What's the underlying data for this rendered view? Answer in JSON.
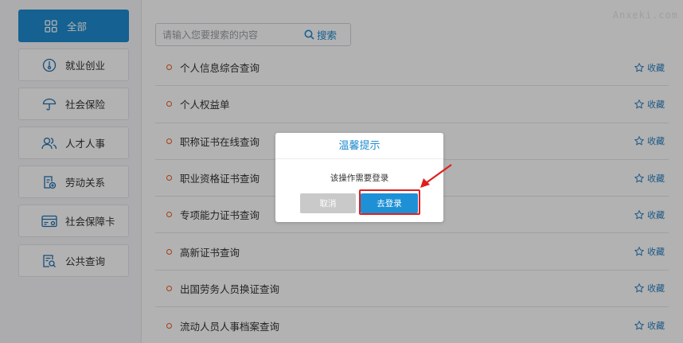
{
  "sidebar": {
    "items": [
      {
        "label": "全部",
        "icon": "grid-icon"
      },
      {
        "label": "就业创业",
        "icon": "thermometer-icon"
      },
      {
        "label": "社会保险",
        "icon": "umbrella-icon"
      },
      {
        "label": "人才人事",
        "icon": "users-icon"
      },
      {
        "label": "劳动关系",
        "icon": "document-plus-icon"
      },
      {
        "label": "社会保障卡",
        "icon": "card-icon"
      },
      {
        "label": "公共查询",
        "icon": "search-document-icon"
      }
    ]
  },
  "search": {
    "placeholder": "请输入您要搜索的内容",
    "button_label": "搜索"
  },
  "list": {
    "fav_label": "收藏",
    "items": [
      "个人信息综合查询",
      "个人权益单",
      "职称证书在线查询",
      "职业资格证书查询",
      "专项能力证书查询",
      "高新证书查询",
      "出国劳务人员换证查询",
      "流动人员人事档案查询"
    ]
  },
  "watermark": "Anxeki.com",
  "dialog": {
    "title": "温馨提示",
    "message": "该操作需要登录",
    "cancel_label": "取消",
    "login_label": "去登录"
  },
  "colors": {
    "accent": "#1f8bd0",
    "dot": "#e85a1e",
    "highlight": "#e01e1e"
  }
}
